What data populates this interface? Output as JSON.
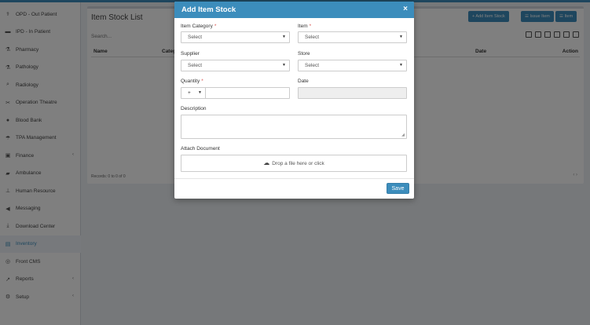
{
  "sidebar": {
    "items": [
      {
        "label": "OPD - Out Patient",
        "icon": "stethoscope-icon",
        "glyph": "⚕",
        "chevron": false
      },
      {
        "label": "IPD - In Patient",
        "icon": "bed-icon",
        "glyph": "▬",
        "chevron": false
      },
      {
        "label": "Pharmacy",
        "icon": "mortar-pestle-icon",
        "glyph": "⚗",
        "chevron": false
      },
      {
        "label": "Pathology",
        "icon": "flask-icon",
        "glyph": "⚗",
        "chevron": false
      },
      {
        "label": "Radiology",
        "icon": "microscope-icon",
        "glyph": "⌕",
        "chevron": false
      },
      {
        "label": "Operation Theatre",
        "icon": "scissors-icon",
        "glyph": "✂",
        "chevron": false
      },
      {
        "label": "Blood Bank",
        "icon": "tint-icon",
        "glyph": "●",
        "chevron": false
      },
      {
        "label": "TPA Management",
        "icon": "umbrella-icon",
        "glyph": "☂",
        "chevron": false
      },
      {
        "label": "Finance",
        "icon": "money-icon",
        "glyph": "▣",
        "chevron": true
      },
      {
        "label": "Ambulance",
        "icon": "ambulance-icon",
        "glyph": "▰",
        "chevron": false
      },
      {
        "label": "Human Resource",
        "icon": "sitemap-icon",
        "glyph": "⊥",
        "chevron": false
      },
      {
        "label": "Messaging",
        "icon": "bullhorn-icon",
        "glyph": "◀",
        "chevron": false
      },
      {
        "label": "Download Center",
        "icon": "download-icon",
        "glyph": "⤓",
        "chevron": false
      },
      {
        "label": "Inventory",
        "icon": "inventory-icon",
        "glyph": "▤",
        "chevron": false
      },
      {
        "label": "Front CMS",
        "icon": "cms-icon",
        "glyph": "◎",
        "chevron": false
      },
      {
        "label": "Reports",
        "icon": "line-chart-icon",
        "glyph": "↗",
        "chevron": true
      },
      {
        "label": "Setup",
        "icon": "gears-icon",
        "glyph": "⚙",
        "chevron": true
      }
    ],
    "active_index": 13
  },
  "list": {
    "title": "Item Stock List",
    "search_placeholder": "Search...",
    "buttons": {
      "add_item_stock": "+ Add Item Stock",
      "issue_item": "☰ Issue Item",
      "item": "☰ Item"
    },
    "columns": [
      "Name",
      "Categ",
      "Date",
      "Action"
    ],
    "records": "Records: 0 to 0 of 0",
    "pager": "‹ ›"
  },
  "modal": {
    "title": "Add Item Stock",
    "close": "×",
    "fields": {
      "item_category": {
        "label": "Item Category",
        "value": "Select"
      },
      "item": {
        "label": "Item",
        "value": "Select"
      },
      "supplier": {
        "label": "Supplier",
        "value": "Select"
      },
      "store": {
        "label": "Store",
        "value": "Select"
      },
      "quantity": {
        "label": "Quantity",
        "sign": "+"
      },
      "date": {
        "label": "Date",
        "value": ""
      },
      "description": {
        "label": "Description",
        "value": ""
      },
      "attach": {
        "label": "Attach Document",
        "drop_text": "Drop a file here or click"
      }
    },
    "required_mark": "*",
    "save_label": "Save"
  },
  "colors": {
    "primary": "#3c8dbc",
    "required": "#d9534f"
  }
}
